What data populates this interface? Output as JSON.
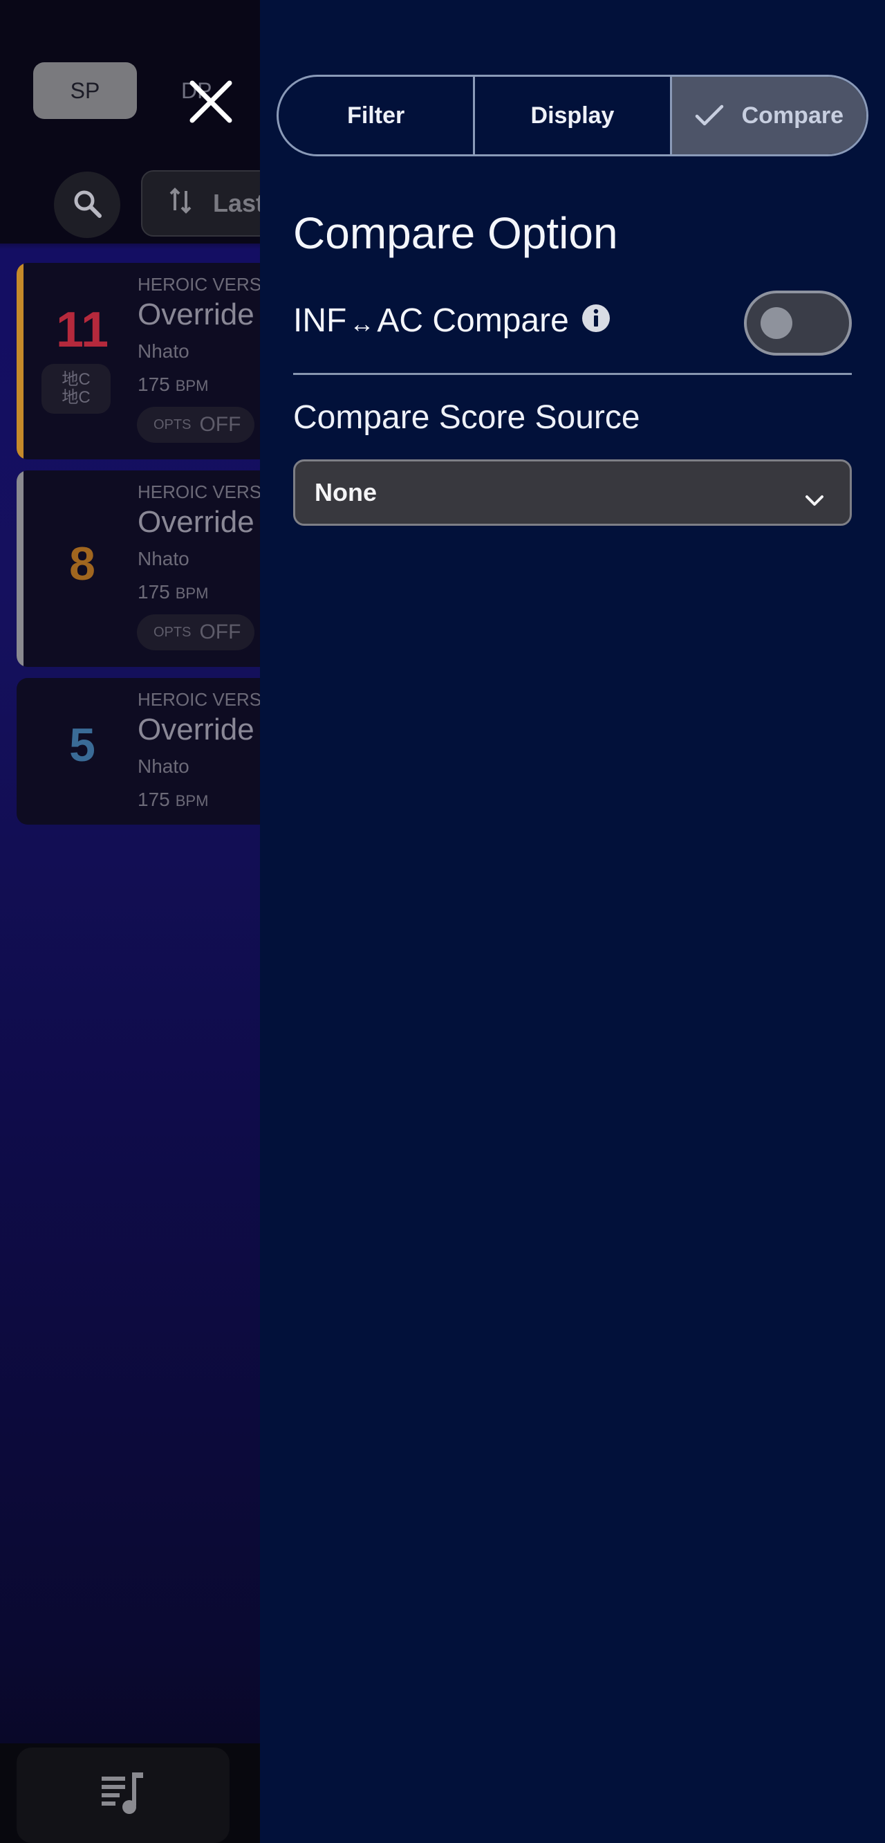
{
  "background_list": {
    "mode_tabs": {
      "sp": "SP",
      "dp": "DP"
    },
    "sort_label": "Last",
    "cards": [
      {
        "level": "11",
        "level_color": "#b5293c",
        "stripe_color": "#c58a2a",
        "version": "HEROIC VERSE",
        "title": "Override",
        "artist": "Nhato",
        "bpm": "175",
        "bpm_unit": "BPM",
        "opts_key": "OPTS",
        "opts_value": "OFF",
        "badge_line1": "地C",
        "badge_line2": "地C"
      },
      {
        "level": "8",
        "level_color": "#a0661f",
        "stripe_color": "#8a8a90",
        "version": "HEROIC VERSE",
        "title": "Override",
        "artist": "Nhato",
        "bpm": "175",
        "bpm_unit": "BPM",
        "opts_key": "OPTS",
        "opts_value": "OFF"
      },
      {
        "level": "5",
        "level_color": "#3a6b96",
        "stripe_color": "#0e0c22",
        "version": "HEROIC VERSE",
        "title": "Override",
        "artist": "Nhato",
        "bpm": "175",
        "bpm_unit": "BPM"
      }
    ]
  },
  "panel": {
    "tabs": [
      {
        "label": "Filter",
        "active": false
      },
      {
        "label": "Display",
        "active": false
      },
      {
        "label": "Compare",
        "active": true
      }
    ],
    "section_title": "Compare Option",
    "inf_ac": {
      "left": "INF",
      "arrow": "↔",
      "right": "AC Compare",
      "enabled": false
    },
    "score_source": {
      "label": "Compare Score Source",
      "selected": "None"
    }
  },
  "icons": {
    "close": "close-icon",
    "search": "search-icon",
    "sort": "sort-icon",
    "check": "check-icon",
    "info": "info-icon",
    "chevron": "chevron-down-icon",
    "music_list": "music-list-icon"
  }
}
